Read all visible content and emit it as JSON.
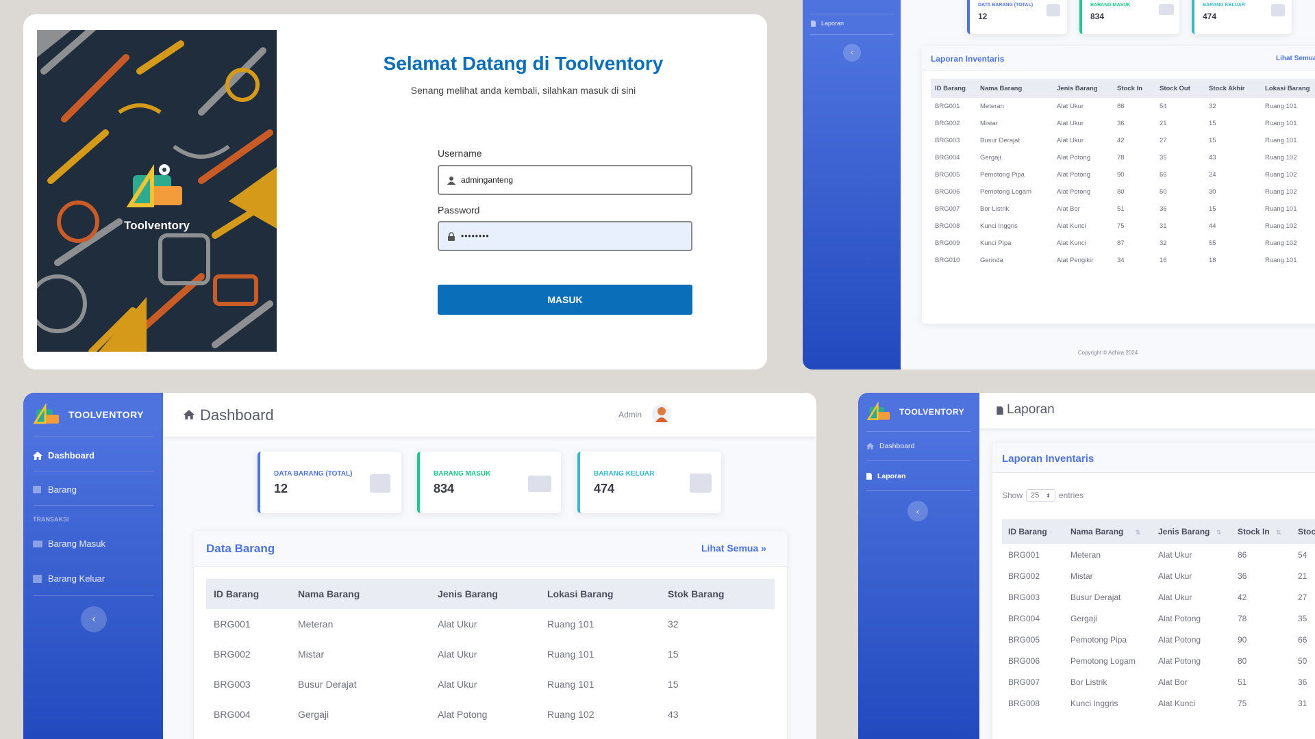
{
  "login": {
    "app_name": "Toolventory",
    "title": "Selamat Datang di Toolventory",
    "subtitle": "Senang melihat anda kembali, silahkan masuk di sini",
    "username_label": "Username",
    "username_value": "adminganteng",
    "password_label": "Password",
    "password_value": "••••••••",
    "submit_label": "MASUK"
  },
  "brand": {
    "name": "TOOLVENTORY"
  },
  "stats": {
    "total_label": "DATA BARANG (TOTAL)",
    "total_value": "12",
    "in_label": "BARANG MASUK",
    "in_value": "834",
    "out_label": "BARANG KELUAR",
    "out_value": "474"
  },
  "report_top": {
    "nav_label": "Laporan",
    "card_title": "Laporan Inventaris",
    "see_all": "Lihat Semua",
    "columns": [
      "ID Barang",
      "Nama Barang",
      "Jenis Barang",
      "Stock In",
      "Stock Out",
      "Stock Akhir",
      "Lokasi Barang"
    ],
    "rows": [
      [
        "BRG001",
        "Meteran",
        "Alat Ukur",
        "86",
        "54",
        "32",
        "Ruang 101"
      ],
      [
        "BRG002",
        "Mistar",
        "Alat Ukur",
        "36",
        "21",
        "15",
        "Ruang 101"
      ],
      [
        "BRG003",
        "Busur Derajat",
        "Alat Ukur",
        "42",
        "27",
        "15",
        "Ruang 101"
      ],
      [
        "BRG004",
        "Gergaji",
        "Alat Potong",
        "78",
        "35",
        "43",
        "Ruang 102"
      ],
      [
        "BRG005",
        "Pemotong Pipa",
        "Alat Potong",
        "90",
        "66",
        "24",
        "Ruang 102"
      ],
      [
        "BRG006",
        "Pemotong Logam",
        "Alat Potong",
        "80",
        "50",
        "30",
        "Ruang 102"
      ],
      [
        "BRG007",
        "Bor Listrik",
        "Alat Bor",
        "51",
        "36",
        "15",
        "Ruang 101"
      ],
      [
        "BRG008",
        "Kunci Inggris",
        "Alat Kunci",
        "75",
        "31",
        "44",
        "Ruang 102"
      ],
      [
        "BRG009",
        "Kunci Pipa",
        "Alat Kunci",
        "87",
        "32",
        "55",
        "Ruang 102"
      ],
      [
        "BRG010",
        "Gerinda",
        "Alat Pengikir",
        "34",
        "16",
        "18",
        "Ruang 101"
      ]
    ],
    "footer": "Copyright © Adhira 2024"
  },
  "dashboard": {
    "page_title": "Dashboard",
    "user_name": "Admin",
    "nav": {
      "dashboard": "Dashboard",
      "barang": "Barang",
      "section": "TRANSAKSI",
      "masuk": "Barang Masuk",
      "keluar": "Barang Keluar"
    },
    "card_title": "Data Barang",
    "see_all": "Lihat Semua",
    "columns": [
      "ID Barang",
      "Nama Barang",
      "Jenis Barang",
      "Lokasi Barang",
      "Stok Barang"
    ],
    "rows": [
      [
        "BRG001",
        "Meteran",
        "Alat Ukur",
        "Ruang 101",
        "32"
      ],
      [
        "BRG002",
        "Mistar",
        "Alat Ukur",
        "Ruang 101",
        "15"
      ],
      [
        "BRG003",
        "Busur Derajat",
        "Alat Ukur",
        "Ruang 101",
        "15"
      ],
      [
        "BRG004",
        "Gergaji",
        "Alat Potong",
        "Ruang 102",
        "43"
      ]
    ]
  },
  "laporan": {
    "page_title": "Laporan",
    "nav": {
      "dashboard": "Dashboard",
      "laporan": "Laporan"
    },
    "card_title": "Laporan Inventaris",
    "show_label": "Show",
    "entries_value": "25",
    "entries_label": "entries",
    "columns": [
      "ID Barang",
      "Nama Barang",
      "Jenis Barang",
      "Stock In",
      "Stoc"
    ],
    "rows": [
      [
        "BRG001",
        "Meteran",
        "Alat Ukur",
        "86",
        "54"
      ],
      [
        "BRG002",
        "Mistar",
        "Alat Ukur",
        "36",
        "21"
      ],
      [
        "BRG003",
        "Busur Derajat",
        "Alat Ukur",
        "42",
        "27"
      ],
      [
        "BRG004",
        "Gergaji",
        "Alat Potong",
        "78",
        "35"
      ],
      [
        "BRG005",
        "Pemotong Pipa",
        "Alat Potong",
        "90",
        "66"
      ],
      [
        "BRG006",
        "Pemotong Logam",
        "Alat Potong",
        "80",
        "50"
      ],
      [
        "BRG007",
        "Bor Listrik",
        "Alat Bor",
        "51",
        "36"
      ],
      [
        "BRG008",
        "Kunci Inggris",
        "Alat Kunci",
        "75",
        "31"
      ]
    ]
  },
  "colors": {
    "primary": "#4e73df",
    "success": "#1cc88a",
    "info": "#36b9cc",
    "login_blue": "#0a6eb8"
  }
}
